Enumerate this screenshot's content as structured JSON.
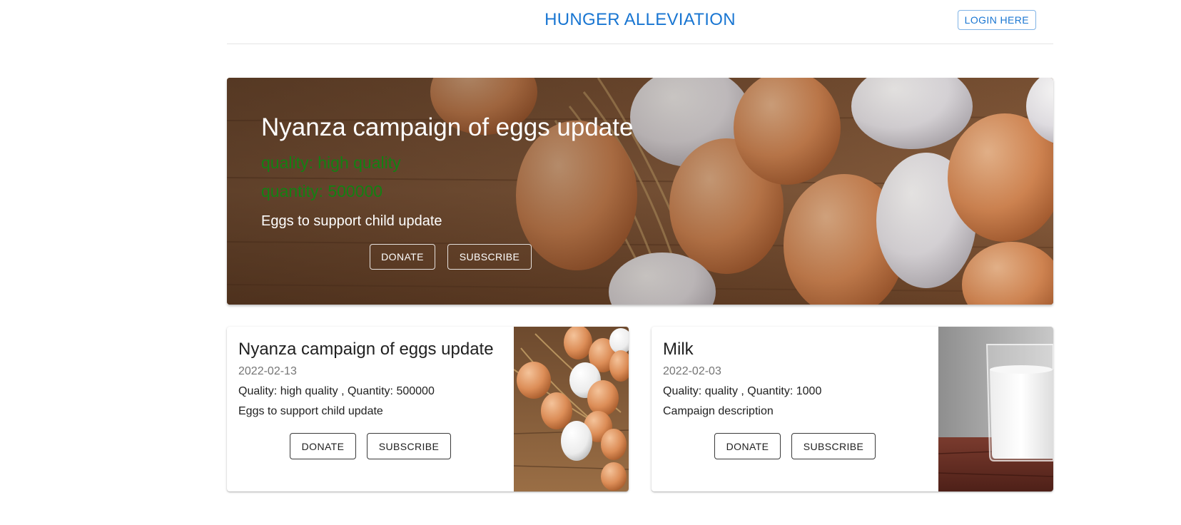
{
  "header": {
    "title": "HUNGER ALLEVIATION",
    "login_label": "LOGIN HERE",
    "accent_color": "#1976d2"
  },
  "hero": {
    "title": "Nyanza campaign of eggs update",
    "quality": "quality: high quality",
    "quantity": "quantity: 500000",
    "description": "Eggs to support child update",
    "donate_label": "DONATE",
    "subscribe_label": "SUBSCRIBE",
    "image": "eggs-photo"
  },
  "campaigns": [
    {
      "title": "Nyanza campaign of eggs update",
      "date": "2022-02-13",
      "quality_quantity": "Quality: high quality , Quantity: 500000",
      "description": "Eggs to support child update",
      "donate_label": "DONATE",
      "subscribe_label": "SUBSCRIBE",
      "image": "eggs-photo"
    },
    {
      "title": "Milk",
      "date": "2022-02-03",
      "quality_quantity": "Quality: quality , Quantity: 1000",
      "description": "Campaign description",
      "donate_label": "DONATE",
      "subscribe_label": "SUBSCRIBE",
      "image": "milk-glass-photo"
    }
  ]
}
